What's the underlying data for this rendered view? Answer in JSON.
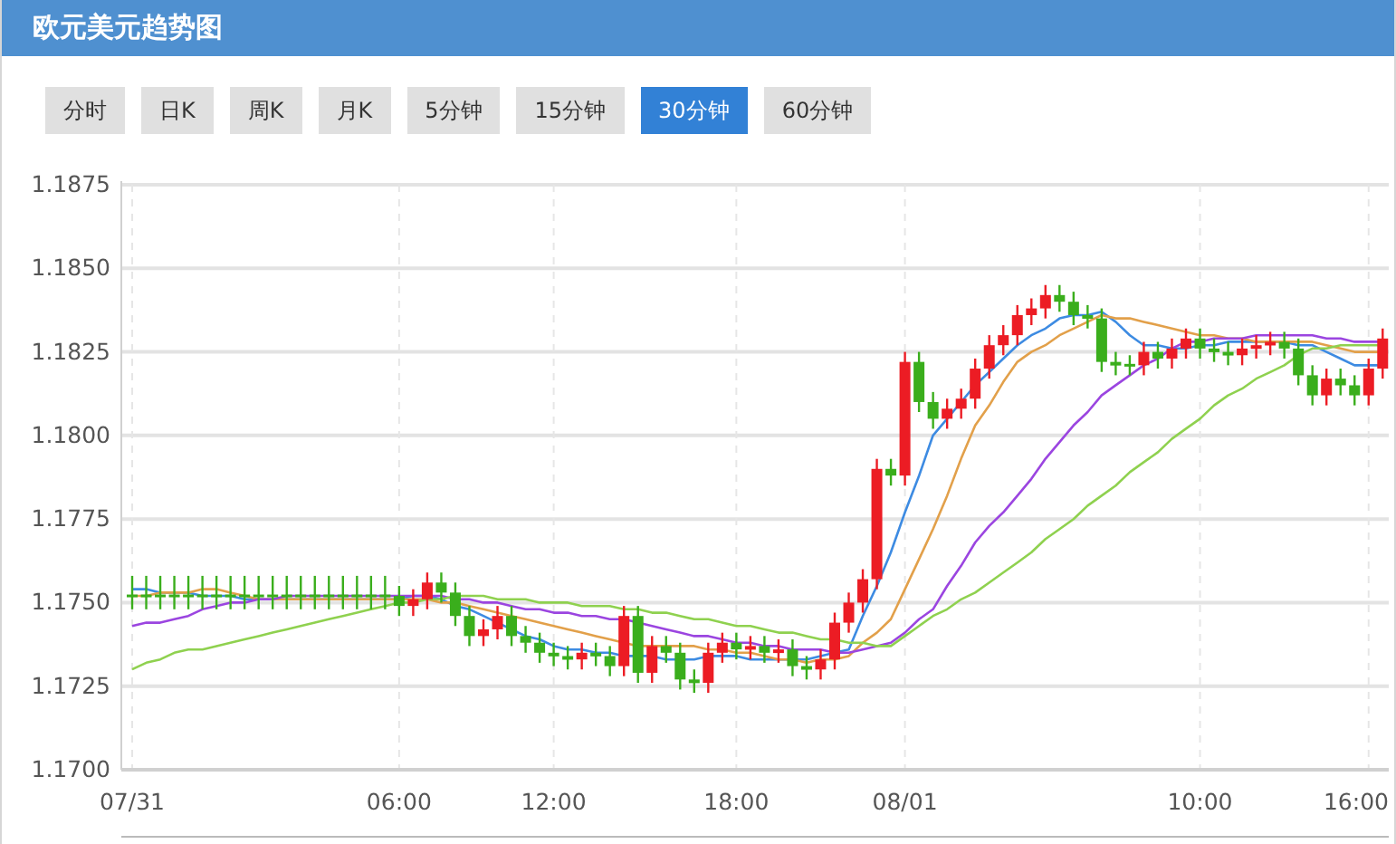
{
  "header": {
    "title": "欧元美元趋势图"
  },
  "tabs": [
    {
      "label": "分时",
      "selected": false
    },
    {
      "label": "日K",
      "selected": false
    },
    {
      "label": "周K",
      "selected": false
    },
    {
      "label": "月K",
      "selected": false
    },
    {
      "label": "5分钟",
      "selected": false
    },
    {
      "label": "15分钟",
      "selected": false
    },
    {
      "label": "30分钟",
      "selected": true
    },
    {
      "label": "60分钟",
      "selected": false
    }
  ],
  "chart": {
    "chart_data": {
      "type": "line",
      "grid": true,
      "ylim": [
        1.17,
        1.1875
      ],
      "yticks": [
        {
          "value": 1.17,
          "label": "1.1700"
        },
        {
          "value": 1.1725,
          "label": "1.1725"
        },
        {
          "value": 1.175,
          "label": "1.1750"
        },
        {
          "value": 1.1775,
          "label": "1.1775"
        },
        {
          "value": 1.18,
          "label": "1.1800"
        },
        {
          "value": 1.1825,
          "label": "1.1825"
        },
        {
          "value": 1.185,
          "label": "1.1850"
        },
        {
          "value": 1.1875,
          "label": "1.1875"
        }
      ],
      "categories": [
        "07/31",
        null,
        null,
        null,
        null,
        null,
        null,
        null,
        null,
        null,
        null,
        null,
        null,
        null,
        null,
        null,
        null,
        null,
        null,
        "06:00",
        null,
        null,
        null,
        null,
        null,
        null,
        null,
        null,
        null,
        null,
        "12:00",
        null,
        null,
        null,
        null,
        null,
        null,
        null,
        null,
        null,
        null,
        null,
        null,
        "18:00",
        null,
        null,
        null,
        null,
        null,
        null,
        null,
        null,
        null,
        null,
        null,
        "08/01",
        null,
        null,
        null,
        null,
        null,
        null,
        null,
        null,
        null,
        null,
        null,
        null,
        null,
        null,
        null,
        null,
        null,
        null,
        null,
        null,
        "10:00",
        null,
        null,
        null,
        null,
        null,
        null,
        null,
        null,
        null,
        null,
        null,
        "16:00",
        null
      ],
      "series": [
        {
          "color": "#3d8be2",
          "values": [
            1.1754,
            1.1754,
            1.1753,
            1.1753,
            1.1753,
            1.1752,
            1.1752,
            1.1752,
            1.1751,
            1.1751,
            1.1751,
            1.1751,
            1.1751,
            1.1751,
            1.1751,
            1.1751,
            1.1751,
            1.1751,
            1.1751,
            1.1751,
            1.1752,
            1.1752,
            1.1751,
            1.1749,
            1.1748,
            1.1746,
            1.1744,
            1.1742,
            1.174,
            1.1739,
            1.1737,
            1.1736,
            1.1736,
            1.1735,
            1.1735,
            1.1734,
            1.1734,
            1.1734,
            1.1733,
            1.1733,
            1.1733,
            1.1734,
            1.1734,
            1.1734,
            1.1733,
            1.1733,
            1.1733,
            1.1733,
            1.1733,
            1.1734,
            1.1735,
            1.1736,
            1.1746,
            1.1755,
            1.1765,
            1.1777,
            1.1788,
            1.18,
            1.1805,
            1.181,
            1.1815,
            1.1819,
            1.1823,
            1.1827,
            1.183,
            1.1832,
            1.1835,
            1.1836,
            1.1836,
            1.1837,
            1.1834,
            1.183,
            1.1827,
            1.1827,
            1.1826,
            1.1826,
            1.1827,
            1.1827,
            1.1828,
            1.1828,
            1.1828,
            1.1828,
            1.1828,
            1.1827,
            1.1827,
            1.1825,
            1.1823,
            1.1821,
            1.1821,
            1.1821
          ]
        },
        {
          "color": "#e2a04a",
          "values": [
            1.1752,
            1.1752,
            1.1753,
            1.1753,
            1.1753,
            1.1754,
            1.1754,
            1.1753,
            1.1752,
            1.1751,
            1.1751,
            1.1751,
            1.1751,
            1.1751,
            1.1751,
            1.1751,
            1.1751,
            1.1751,
            1.1751,
            1.1751,
            1.1751,
            1.1751,
            1.175,
            1.175,
            1.1749,
            1.1748,
            1.1747,
            1.1746,
            1.1745,
            1.1744,
            1.1743,
            1.1742,
            1.1741,
            1.174,
            1.1739,
            1.1738,
            1.1737,
            1.1737,
            1.1737,
            1.1737,
            1.1737,
            1.1736,
            1.1736,
            1.1735,
            1.1735,
            1.1734,
            1.1733,
            1.1733,
            1.1732,
            1.1733,
            1.1733,
            1.1734,
            1.1738,
            1.1741,
            1.1745,
            1.1754,
            1.1763,
            1.1772,
            1.1782,
            1.1793,
            1.1803,
            1.1809,
            1.1816,
            1.1822,
            1.1825,
            1.1827,
            1.183,
            1.1832,
            1.1834,
            1.1836,
            1.1835,
            1.1835,
            1.1834,
            1.1833,
            1.1832,
            1.1831,
            1.183,
            1.183,
            1.1829,
            1.1829,
            1.1828,
            1.1828,
            1.1828,
            1.1828,
            1.1828,
            1.1827,
            1.1826,
            1.1825,
            1.1825,
            1.1825
          ]
        },
        {
          "color": "#9b45e0",
          "values": [
            1.1743,
            1.1744,
            1.1744,
            1.1745,
            1.1746,
            1.1748,
            1.1749,
            1.175,
            1.175,
            1.1751,
            1.1751,
            1.1752,
            1.1752,
            1.1752,
            1.1752,
            1.1752,
            1.1752,
            1.1752,
            1.1752,
            1.1752,
            1.1752,
            1.1752,
            1.1752,
            1.1751,
            1.1751,
            1.175,
            1.175,
            1.1749,
            1.1748,
            1.1748,
            1.1747,
            1.1747,
            1.1746,
            1.1746,
            1.1745,
            1.1745,
            1.1744,
            1.1743,
            1.1742,
            1.1741,
            1.174,
            1.174,
            1.1739,
            1.1738,
            1.1738,
            1.1737,
            1.1737,
            1.1736,
            1.1736,
            1.1736,
            1.1735,
            1.1735,
            1.1736,
            1.1737,
            1.1738,
            1.1741,
            1.1745,
            1.1748,
            1.1755,
            1.1761,
            1.1768,
            1.1773,
            1.1777,
            1.1782,
            1.1787,
            1.1793,
            1.1798,
            1.1803,
            1.1807,
            1.1812,
            1.1815,
            1.1818,
            1.1821,
            1.1823,
            1.1826,
            1.1828,
            1.1828,
            1.1829,
            1.1829,
            1.1829,
            1.183,
            1.183,
            1.183,
            1.183,
            1.183,
            1.1829,
            1.1829,
            1.1828,
            1.1828,
            1.1828
          ]
        },
        {
          "color": "#8fd14f",
          "values": [
            1.173,
            1.1732,
            1.1733,
            1.1735,
            1.1736,
            1.1736,
            1.1737,
            1.1738,
            1.1739,
            1.174,
            1.1741,
            1.1742,
            1.1743,
            1.1744,
            1.1745,
            1.1746,
            1.1747,
            1.1748,
            1.1749,
            1.175,
            1.175,
            1.1751,
            1.1751,
            1.1752,
            1.1752,
            1.1752,
            1.1751,
            1.1751,
            1.1751,
            1.175,
            1.175,
            1.175,
            1.1749,
            1.1749,
            1.1749,
            1.1748,
            1.1748,
            1.1747,
            1.1747,
            1.1746,
            1.1745,
            1.1745,
            1.1744,
            1.1743,
            1.1743,
            1.1742,
            1.1741,
            1.1741,
            1.174,
            1.1739,
            1.1739,
            1.1738,
            1.1738,
            1.1737,
            1.1737,
            1.174,
            1.1743,
            1.1746,
            1.1748,
            1.1751,
            1.1753,
            1.1756,
            1.1759,
            1.1762,
            1.1765,
            1.1769,
            1.1772,
            1.1775,
            1.1779,
            1.1782,
            1.1785,
            1.1789,
            1.1792,
            1.1795,
            1.1799,
            1.1802,
            1.1805,
            1.1809,
            1.1812,
            1.1814,
            1.1817,
            1.1819,
            1.1821,
            1.1824,
            1.1826,
            1.1826,
            1.1827,
            1.1827,
            1.1827,
            1.1827
          ]
        }
      ]
    }
  },
  "candles": {
    "chart_data": {
      "type": "candlestick",
      "ylim": [
        1.17,
        1.1875
      ],
      "ohlc": [
        [
          1.1752,
          1.1758,
          1.1748,
          1.1752
        ],
        [
          1.1752,
          1.1758,
          1.1748,
          1.1752
        ],
        [
          1.1752,
          1.1758,
          1.1748,
          1.1752
        ],
        [
          1.1752,
          1.1758,
          1.1748,
          1.1752
        ],
        [
          1.1752,
          1.1758,
          1.1748,
          1.1752
        ],
        [
          1.1752,
          1.1758,
          1.1748,
          1.1752
        ],
        [
          1.1752,
          1.1758,
          1.1748,
          1.1752
        ],
        [
          1.1752,
          1.1758,
          1.1748,
          1.1752
        ],
        [
          1.1752,
          1.1758,
          1.1748,
          1.1752
        ],
        [
          1.1752,
          1.1758,
          1.1748,
          1.1752
        ],
        [
          1.1752,
          1.1758,
          1.1748,
          1.1752
        ],
        [
          1.1752,
          1.1758,
          1.1748,
          1.1752
        ],
        [
          1.1752,
          1.1758,
          1.1748,
          1.1752
        ],
        [
          1.1752,
          1.1758,
          1.1748,
          1.1752
        ],
        [
          1.1752,
          1.1758,
          1.1748,
          1.1752
        ],
        [
          1.1752,
          1.1758,
          1.1748,
          1.1752
        ],
        [
          1.1752,
          1.1758,
          1.1748,
          1.1752
        ],
        [
          1.1752,
          1.1758,
          1.1748,
          1.1752
        ],
        [
          1.1752,
          1.1758,
          1.1748,
          1.1752
        ],
        [
          1.1752,
          1.1755,
          1.1746,
          1.1749
        ],
        [
          1.1749,
          1.1754,
          1.1746,
          1.1751
        ],
        [
          1.1751,
          1.1759,
          1.1748,
          1.1756
        ],
        [
          1.1756,
          1.1759,
          1.175,
          1.1753
        ],
        [
          1.1753,
          1.1756,
          1.1743,
          1.1746
        ],
        [
          1.1746,
          1.1749,
          1.1737,
          1.174
        ],
        [
          1.174,
          1.1745,
          1.1737,
          1.1742
        ],
        [
          1.1742,
          1.1749,
          1.1739,
          1.1746
        ],
        [
          1.1746,
          1.1749,
          1.1737,
          1.174
        ],
        [
          1.174,
          1.1743,
          1.1735,
          1.1738
        ],
        [
          1.1738,
          1.1741,
          1.1732,
          1.1735
        ],
        [
          1.1735,
          1.1738,
          1.1731,
          1.1734
        ],
        [
          1.1734,
          1.1737,
          1.173,
          1.1733
        ],
        [
          1.1733,
          1.1738,
          1.173,
          1.1735
        ],
        [
          1.1735,
          1.1738,
          1.1731,
          1.1734
        ],
        [
          1.1734,
          1.1737,
          1.1728,
          1.1731
        ],
        [
          1.1731,
          1.1749,
          1.1728,
          1.1746
        ],
        [
          1.1746,
          1.1749,
          1.1726,
          1.1729
        ],
        [
          1.1729,
          1.174,
          1.1726,
          1.1737
        ],
        [
          1.1737,
          1.174,
          1.1732,
          1.1735
        ],
        [
          1.1735,
          1.1738,
          1.1724,
          1.1727
        ],
        [
          1.1727,
          1.173,
          1.1723,
          1.1726
        ],
        [
          1.1726,
          1.1738,
          1.1723,
          1.1735
        ],
        [
          1.1735,
          1.1741,
          1.1732,
          1.1738
        ],
        [
          1.1738,
          1.1741,
          1.1733,
          1.1736
        ],
        [
          1.1736,
          1.174,
          1.1733,
          1.1737
        ],
        [
          1.1737,
          1.174,
          1.1732,
          1.1735
        ],
        [
          1.1735,
          1.1739,
          1.1732,
          1.1736
        ],
        [
          1.1736,
          1.1739,
          1.1728,
          1.1731
        ],
        [
          1.1731,
          1.1734,
          1.1727,
          1.173
        ],
        [
          1.173,
          1.1736,
          1.1727,
          1.1733
        ],
        [
          1.1733,
          1.1747,
          1.173,
          1.1744
        ],
        [
          1.1744,
          1.1753,
          1.1741,
          1.175
        ],
        [
          1.175,
          1.176,
          1.1747,
          1.1757
        ],
        [
          1.1757,
          1.1793,
          1.1754,
          1.179
        ],
        [
          1.179,
          1.1793,
          1.1785,
          1.1788
        ],
        [
          1.1788,
          1.1825,
          1.1785,
          1.1822
        ],
        [
          1.1822,
          1.1825,
          1.1807,
          1.181
        ],
        [
          1.181,
          1.1813,
          1.1802,
          1.1805
        ],
        [
          1.1805,
          1.1811,
          1.1802,
          1.1808
        ],
        [
          1.1808,
          1.1814,
          1.1805,
          1.1811
        ],
        [
          1.1811,
          1.1823,
          1.1808,
          1.182
        ],
        [
          1.182,
          1.183,
          1.1817,
          1.1827
        ],
        [
          1.1827,
          1.1833,
          1.1824,
          1.183
        ],
        [
          1.183,
          1.1839,
          1.1827,
          1.1836
        ],
        [
          1.1836,
          1.1841,
          1.1833,
          1.1838
        ],
        [
          1.1838,
          1.1845,
          1.1835,
          1.1842
        ],
        [
          1.1842,
          1.1845,
          1.1837,
          1.184
        ],
        [
          1.184,
          1.1843,
          1.1833,
          1.1836
        ],
        [
          1.1836,
          1.1839,
          1.1832,
          1.1835
        ],
        [
          1.1835,
          1.1838,
          1.1819,
          1.1822
        ],
        [
          1.1822,
          1.1825,
          1.1818,
          1.1821
        ],
        [
          1.1821,
          1.1824,
          1.1818,
          1.1821
        ],
        [
          1.1821,
          1.1828,
          1.1818,
          1.1825
        ],
        [
          1.1825,
          1.1828,
          1.182,
          1.1823
        ],
        [
          1.1823,
          1.1829,
          1.182,
          1.1826
        ],
        [
          1.1826,
          1.1832,
          1.1823,
          1.1829
        ],
        [
          1.1829,
          1.1832,
          1.1823,
          1.1826
        ],
        [
          1.1826,
          1.1829,
          1.1822,
          1.1825
        ],
        [
          1.1825,
          1.1828,
          1.1821,
          1.1824
        ],
        [
          1.1824,
          1.1829,
          1.1821,
          1.1826
        ],
        [
          1.1826,
          1.183,
          1.1823,
          1.1827
        ],
        [
          1.1827,
          1.1831,
          1.1824,
          1.1828
        ],
        [
          1.1828,
          1.1831,
          1.1823,
          1.1826
        ],
        [
          1.1826,
          1.1829,
          1.1815,
          1.1818
        ],
        [
          1.1818,
          1.1821,
          1.1809,
          1.1812
        ],
        [
          1.1812,
          1.182,
          1.1809,
          1.1817
        ],
        [
          1.1817,
          1.182,
          1.1812,
          1.1815
        ],
        [
          1.1815,
          1.1818,
          1.1809,
          1.1812
        ],
        [
          1.1812,
          1.1823,
          1.1809,
          1.182
        ],
        [
          1.182,
          1.1832,
          1.1817,
          1.1829
        ]
      ]
    }
  }
}
